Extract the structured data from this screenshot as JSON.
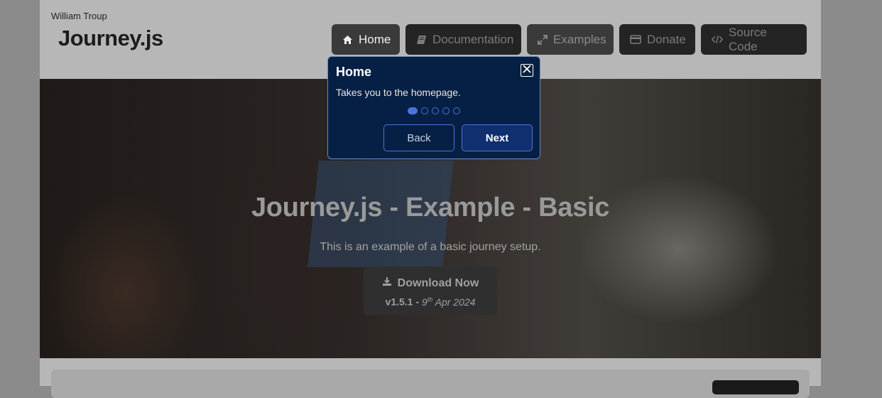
{
  "header": {
    "author": "William Troup",
    "logo": "Journey.js"
  },
  "nav": [
    {
      "label": "Home",
      "icon": "home-icon"
    },
    {
      "label": "Documentation",
      "icon": "book-icon"
    },
    {
      "label": "Examples",
      "icon": "expand-icon"
    },
    {
      "label": "Donate",
      "icon": "credit-card-icon"
    },
    {
      "label": "Source Code",
      "icon": "code-icon"
    }
  ],
  "hero": {
    "title": "Journey.js - Example - Basic",
    "subtitle": "This is an example of a basic journey setup.",
    "download_label": "Download Now",
    "version": "v1.5.1 -",
    "date_day": "9",
    "date_suffix": "th",
    "date_rest": "Apr 2024"
  },
  "popup": {
    "title": "Home",
    "text": "Takes you to the homepage.",
    "back_label": "Back",
    "next_label": "Next",
    "step_current": 1,
    "step_total": 5
  },
  "colors": {
    "popup_bg": "#052044",
    "accent": "#4e73d8",
    "overlay": "#8b8b8b"
  }
}
